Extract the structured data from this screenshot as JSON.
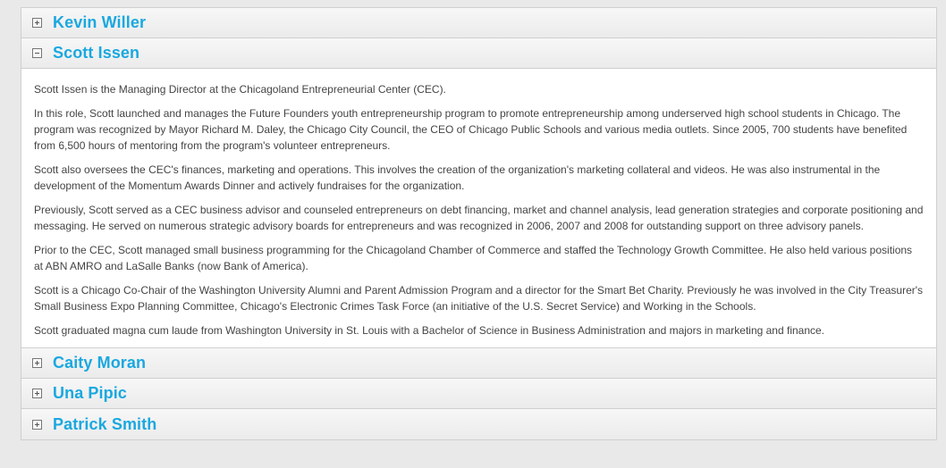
{
  "people": [
    {
      "name": "Kevin Willer",
      "expanded": false
    },
    {
      "name": "Scott Issen",
      "expanded": true
    },
    {
      "name": "Caity Moran",
      "expanded": false
    },
    {
      "name": "Una Pipic",
      "expanded": false
    },
    {
      "name": "Patrick Smith",
      "expanded": false
    }
  ],
  "bio": [
    "Scott Issen is the Managing Director at the Chicagoland Entrepreneurial Center (CEC).",
    "In this role, Scott launched and manages the Future Founders youth entrepreneurship program to promote entrepreneurship among underserved high school students in Chicago. The program was recognized by Mayor Richard M. Daley, the Chicago City Council, the CEO of Chicago Public Schools and various media outlets. Since 2005, 700 students have benefited from 6,500 hours of mentoring from the program's volunteer entrepreneurs.",
    "Scott also oversees the CEC's finances, marketing and operations. This involves the creation of the organization's marketing collateral and videos. He was also instrumental in the development of the Momentum Awards Dinner and actively fundraises for the organization.",
    "Previously, Scott served as a CEC business advisor and counseled entrepreneurs on debt financing, market and channel analysis, lead generation strategies and corporate positioning and messaging. He served on numerous strategic advisory boards for entrepreneurs and was recognized in 2006, 2007 and 2008 for outstanding support on three advisory panels.",
    "Prior to the CEC, Scott managed small business programming for the Chicagoland Chamber of Commerce and staffed the Technology Growth Committee. He also held various positions at ABN AMRO and LaSalle Banks (now Bank of America).",
    "Scott is a Chicago Co-Chair of the Washington University Alumni and Parent Admission Program and a director for the Smart Bet Charity. Previously he was involved in the City Treasurer's Small Business Expo Planning Committee, Chicago's Electronic Crimes Task Force (an initiative of the U.S. Secret Service) and Working in the Schools.",
    "Scott graduated magna cum laude from Washington University in St. Louis with a Bachelor of Science in Business Administration and majors in marketing and finance."
  ],
  "colors": {
    "title": "#1aa8e0",
    "text": "#444444"
  },
  "icons": {
    "collapsed": "plus-box-icon",
    "expanded": "minus-box-icon"
  }
}
